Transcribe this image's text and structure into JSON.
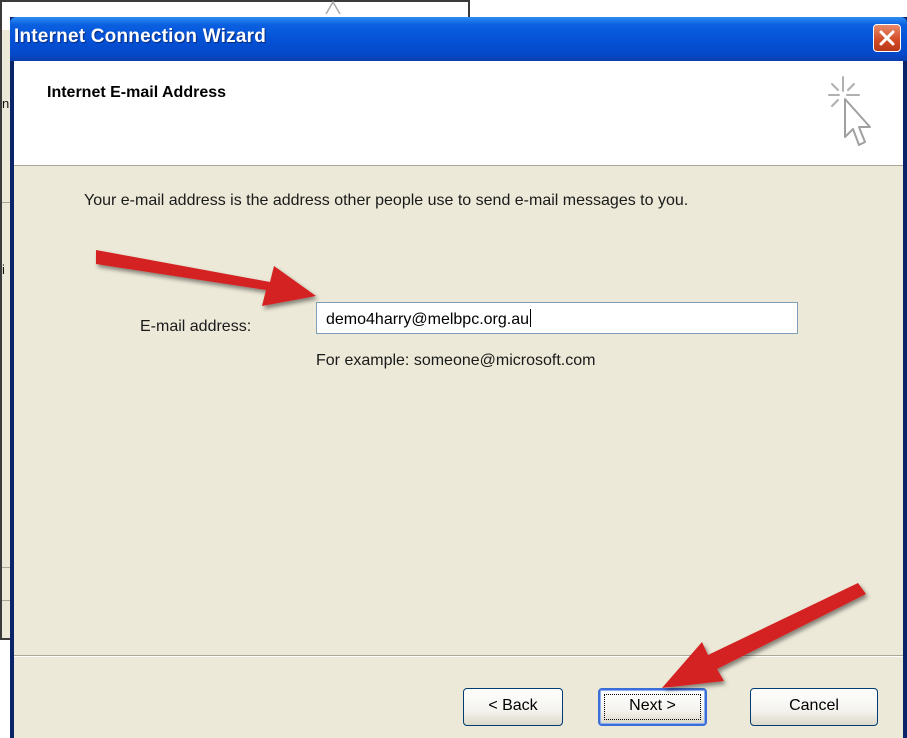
{
  "dialog": {
    "title": "Internet Connection Wizard",
    "header_title": "Internet E-mail Address",
    "description": "Your e-mail address is the address other people use to send e-mail messages to you.",
    "email_label": "E-mail address:",
    "email_value": "demo4harry@melbpc.org.au",
    "example_text": "For example: someone@microsoft.com",
    "buttons": {
      "back": "< Back",
      "next": "Next >",
      "cancel": "Cancel"
    }
  },
  "background_window": {
    "fragment_1": "n",
    "fragment_2": "i"
  },
  "annotations": {
    "arrow_color": "#d42020",
    "arrows": [
      "pointing-to-email-input",
      "pointing-to-next-button"
    ]
  },
  "colors": {
    "titlebar": "#0551d6",
    "client_bg": "#ece9d8",
    "close_button": "#d24a24"
  },
  "icons": [
    "close-icon",
    "wizard-cursor-icon",
    "annotation-arrow-icon"
  ]
}
